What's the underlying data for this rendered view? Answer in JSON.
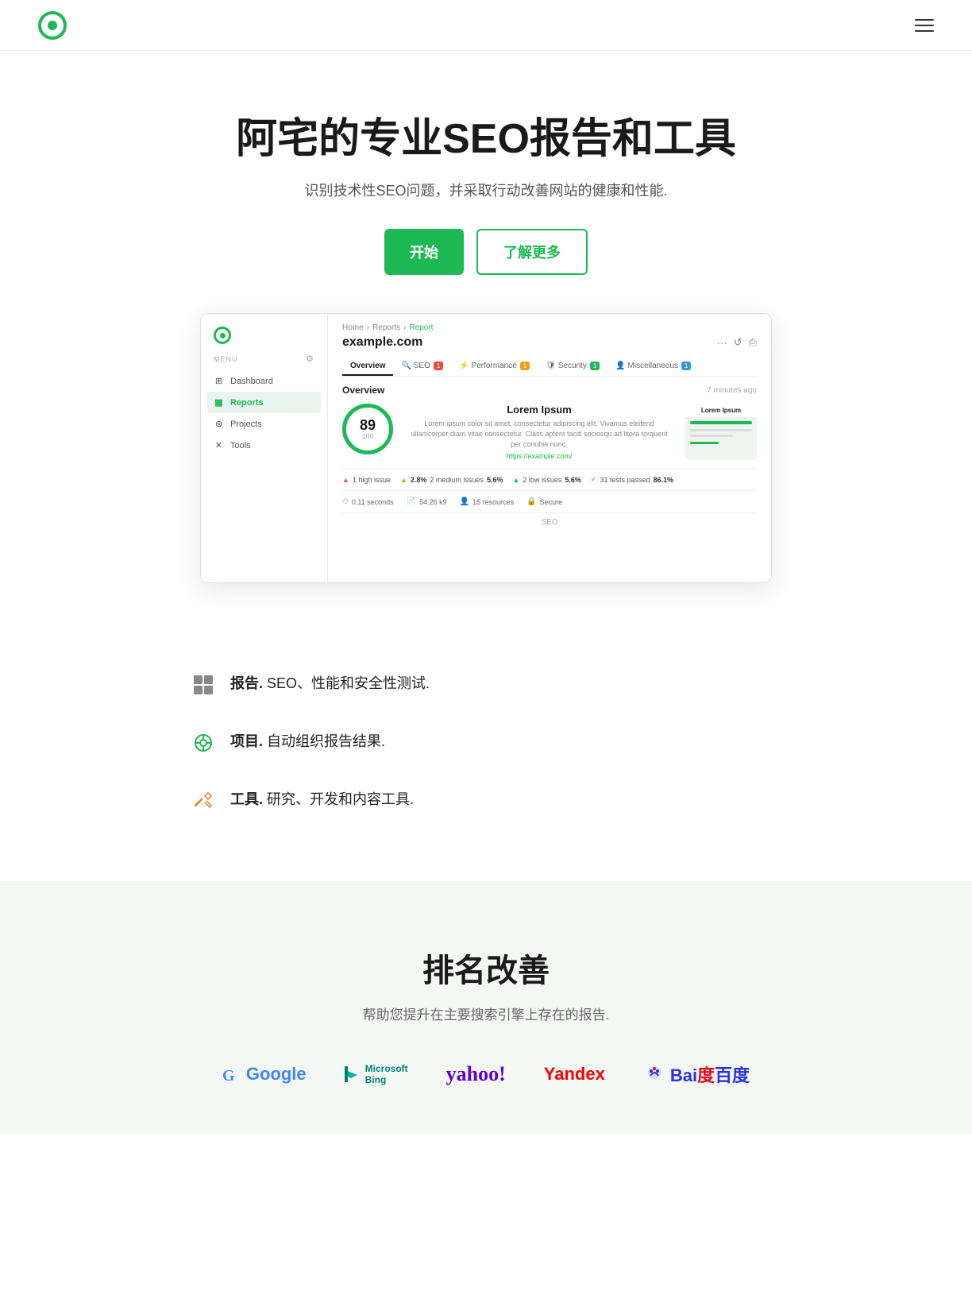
{
  "navbar": {
    "logo_alt": "App Logo",
    "menu_icon": "≡"
  },
  "hero": {
    "title": "阿宅的专业SEO报告和工具",
    "subtitle": "识别技术性SEO问题，并采取行动改善网站的健康和性能.",
    "btn_start": "开始",
    "btn_learn": "了解更多"
  },
  "dashboard": {
    "breadcrumb": [
      "Home",
      "Reports",
      "Report"
    ],
    "site": "example.com",
    "tabs": [
      "Overview",
      "SEO",
      "Performance",
      "Security",
      "Miscellaneous"
    ],
    "tab_badges": [
      "",
      "1",
      "1",
      "1",
      "1"
    ],
    "overview_label": "Overview",
    "overview_time": "7 minutes ago",
    "score": "89",
    "score_denom": "100",
    "site_title": "Lorem Ipsum",
    "site_desc": "Lorem ipsum color sit amet, consectetur adipiscing elit. Vivamus eleifend ullamcorper diam vitae consectetur. Class aptent taciti sociosqu ad litora torquent per conubia nunc.",
    "site_url": "https://example.com/",
    "thumb_title": "Lorem Ipsum",
    "issues": [
      {
        "icon": "▲",
        "color": "#e74c3c",
        "label": "1 high issue"
      },
      {
        "icon": "▲",
        "color": "#f39c12",
        "label": "2 medium issues",
        "pct": "2.8%"
      },
      {
        "icon": "▲",
        "color": "#3498db",
        "label": "2 low issues",
        "pct": "5.6%"
      },
      {
        "icon": "✓",
        "color": "#1db954",
        "label": "31 tests passed",
        "pct": "86.1%"
      }
    ],
    "metrics": [
      {
        "icon": "⏱",
        "label": "0.11 seconds"
      },
      {
        "icon": "📄",
        "label": "54.26 k9"
      },
      {
        "icon": "👤",
        "label": "15 resources"
      },
      {
        "icon": "🔒",
        "label": "Secure"
      }
    ],
    "section_label": "SEO",
    "nav": {
      "menu_label": "MENU",
      "items": [
        "Dashboard",
        "Reports",
        "Projects",
        "Tools"
      ]
    }
  },
  "features": [
    {
      "icon": "grid",
      "title": "报告.",
      "desc": "SEO、性能和安全性测试."
    },
    {
      "icon": "share",
      "title": "项目.",
      "desc": "自动组织报告结果."
    },
    {
      "icon": "wrench",
      "title": "工具.",
      "desc": "研究、开发和内容工具."
    }
  ],
  "ranking": {
    "title": "排名改善",
    "subtitle": "帮助您提升在主要搜索引擎上存在的报告.",
    "engines": [
      "Google",
      "Microsoft\nBing",
      "yahoo!",
      "Yandex",
      "Bai度百度"
    ]
  }
}
